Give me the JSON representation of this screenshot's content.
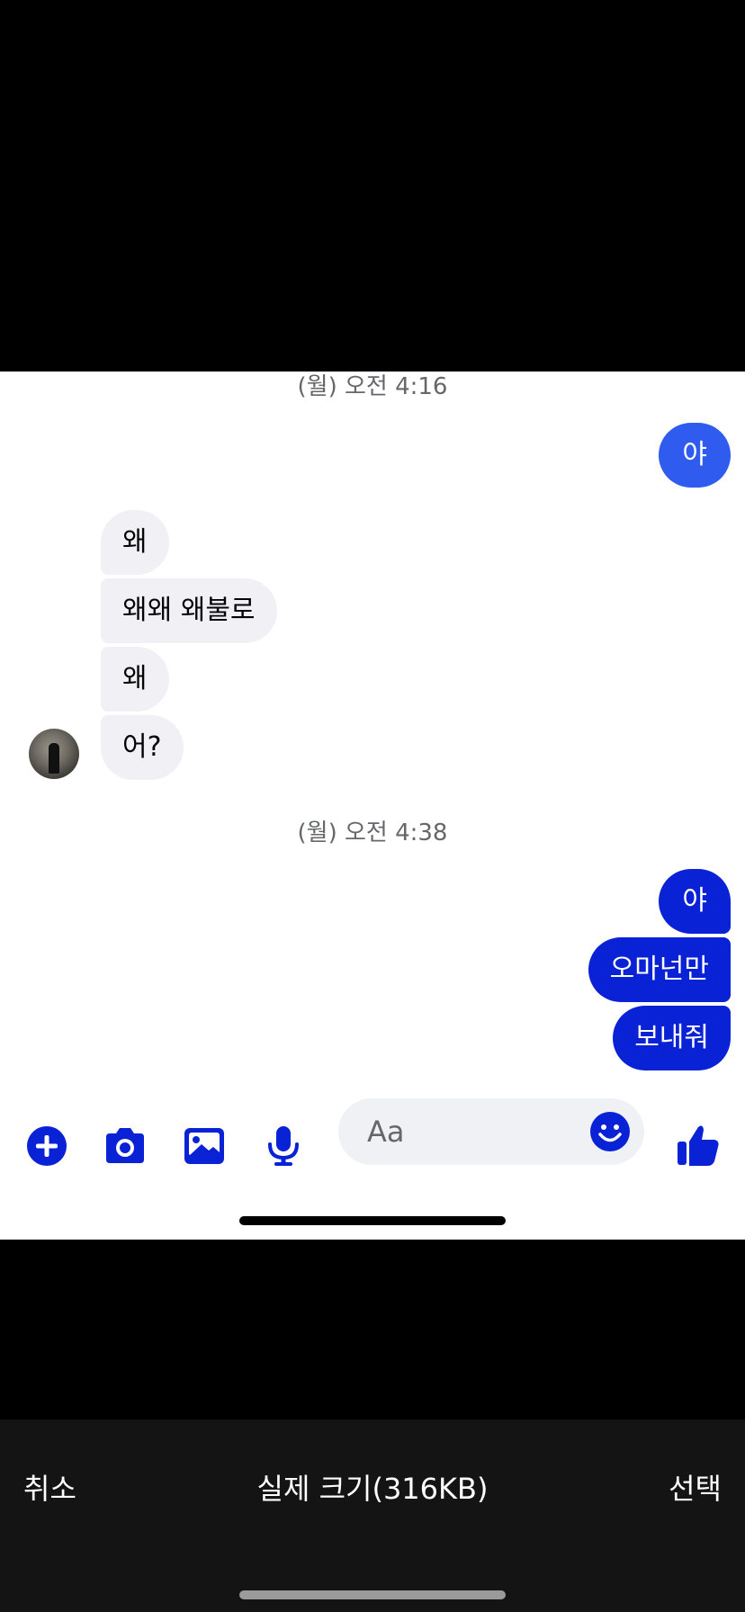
{
  "chat": {
    "timestamps": [
      "(월) 오전 4:16",
      "(월) 오전 4:38"
    ],
    "messages": [
      {
        "side": "out",
        "text": "야"
      },
      {
        "side": "in",
        "text": "왜"
      },
      {
        "side": "in",
        "text": "왜왜 왜불로"
      },
      {
        "side": "in",
        "text": "왜"
      },
      {
        "side": "in",
        "text": "어?"
      },
      {
        "side": "out",
        "text": "야"
      },
      {
        "side": "out",
        "text": "오마넌만"
      },
      {
        "side": "out",
        "text": "보내줘"
      }
    ]
  },
  "composer": {
    "placeholder": "Aa",
    "icons": [
      "plus-icon",
      "camera-icon",
      "gallery-icon",
      "microphone-icon",
      "emoji-icon",
      "thumbs-up-icon"
    ]
  },
  "picker": {
    "cancel_label": "취소",
    "size_label": "실제 크기(316KB)",
    "select_label": "선택"
  },
  "colors": {
    "accent": "#0a22d6",
    "accent_light": "#2f5bef",
    "incoming_bubble": "#f0f0f5",
    "picker_bar": "#141414"
  }
}
